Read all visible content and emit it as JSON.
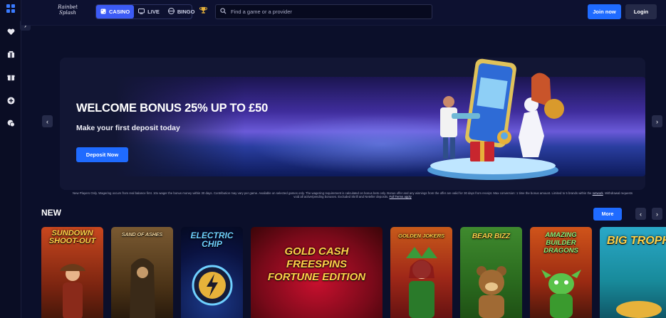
{
  "header": {
    "logo_text": "Rainbet Splash",
    "tabs": [
      {
        "label": "CASINO",
        "icon": "casino-icon",
        "active": true
      },
      {
        "label": "LIVE",
        "icon": "live-icon",
        "active": false
      },
      {
        "label": "BINGO",
        "icon": "bingo-icon",
        "active": false
      }
    ],
    "search_placeholder": "Find a game or a provider",
    "join_label": "Join now",
    "login_label": "Login"
  },
  "sidebar": {
    "items": [
      {
        "icon": "grid-icon"
      },
      {
        "icon": "heart-icon"
      },
      {
        "icon": "gift-box-icon"
      },
      {
        "icon": "gift-icon"
      },
      {
        "icon": "add-circle-icon"
      },
      {
        "icon": "chat-icon"
      }
    ]
  },
  "hero": {
    "title": "WELCOME BONUS 25% UP TO £50",
    "subtitle": "Make your first deposit today",
    "cta_label": "Deposit Now",
    "terms_text": "New Players Only. Wagering occurs from real balance first. 10x wager the bonus money within 30 days. Contribution may vary per game. Available on selected games only. The wagering requirement is calculated on bonus bets only. Bonus offer and any winnings from the offer are valid for 30 days from receipt. Max conversion: 1 time the bonus amount. Limited to 5 brands within the",
    "terms_link": "network",
    "terms_text_2": ". Withdrawal requests void all active/pending bonuses. Excluded Skrill and Neteller deposits.",
    "full_terms_label": "Full Terms apply"
  },
  "new_section": {
    "title": "NEW",
    "more_label": "More",
    "games": [
      {
        "name": "SUNDOWN SHOOT-OUT"
      },
      {
        "name": "SAND OF ASHES"
      },
      {
        "name": "ELECTRIC CHIP"
      },
      {
        "name": "GOLD CASH FREESPINS FORTUNE EDITION"
      },
      {
        "name": "GOLDEN JOKERS"
      },
      {
        "name": "BEAR BIZZ"
      },
      {
        "name": "AMAZING BUILDER DRAGONS"
      },
      {
        "name": "BIG TROPH"
      }
    ]
  },
  "colors": {
    "accent": "#1f6bff",
    "casino_tab": "#3c5bf5",
    "background": "#0b0f2a"
  }
}
